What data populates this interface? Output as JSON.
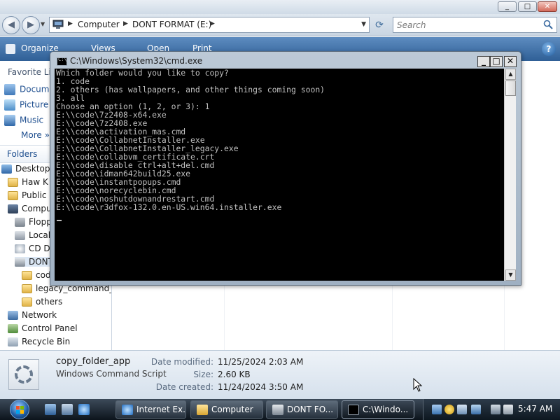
{
  "explorer": {
    "address": {
      "crumbs": [
        "Computer",
        "DONT FORMAT (E:)"
      ]
    },
    "search_placeholder": "Search",
    "toolbar": {
      "organize": "Organize",
      "views": "Views",
      "open": "Open",
      "print": "Print"
    },
    "nav": {
      "favorites_header": "Favorite Lin",
      "favorites": [
        "Docum",
        "Picture",
        "Music",
        "More"
      ],
      "folders_label": "Folders",
      "tree": [
        "Desktop",
        "Haw K",
        "Public",
        "Compu",
        "Flopp",
        "Local",
        "CD D",
        "DONT",
        "cod",
        "legacy_command_p",
        "others",
        "Network",
        "Control Panel",
        "Recycle Bin"
      ]
    },
    "details": {
      "name": "copy_folder_app",
      "type": "Windows Command Script",
      "modified_label": "Date modified:",
      "modified": "11/25/2024 2:03 AM",
      "size_label": "Size:",
      "size": "2.60 KB",
      "created_label": "Date created:",
      "created": "11/24/2024 3:50 AM"
    }
  },
  "cmd": {
    "title": "C:\\Windows\\System32\\cmd.exe",
    "icon_text": "C:\\",
    "lines": [
      "Which folder would you like to copy?",
      "1. code",
      "2. others (has wallpapers, and other things coming soon)",
      "3. all",
      "Choose an option (1, 2, or 3): 1",
      "E:\\\\code\\7z2408-x64.exe",
      "E:\\\\code\\7z2408.exe",
      "E:\\\\code\\activation_mas.cmd",
      "E:\\\\code\\CollabnetInstaller.exe",
      "E:\\\\code\\CollabnetInstaller_legacy.exe",
      "E:\\\\code\\collabvm_certificate.crt",
      "E:\\\\code\\disable ctrl+alt+del.cmd",
      "E:\\\\code\\idman642build25.exe",
      "E:\\\\code\\instantpopups.cmd",
      "E:\\\\code\\norecyclebin.cmd",
      "E:\\\\code\\noshutdownandrestart.cmd",
      "E:\\\\code\\r3dfox-132.0.en-US.win64.installer.exe"
    ]
  },
  "taskbar": {
    "tasks": [
      "Internet Ex...",
      "Computer",
      "DONT FO...",
      "C:\\Windo..."
    ],
    "clock": "5:47 AM"
  },
  "colors": {
    "toolbar": "#2f5f96",
    "console_bg": "#000000",
    "console_text": "#c0c0c0",
    "taskbar": "#0c141c"
  }
}
